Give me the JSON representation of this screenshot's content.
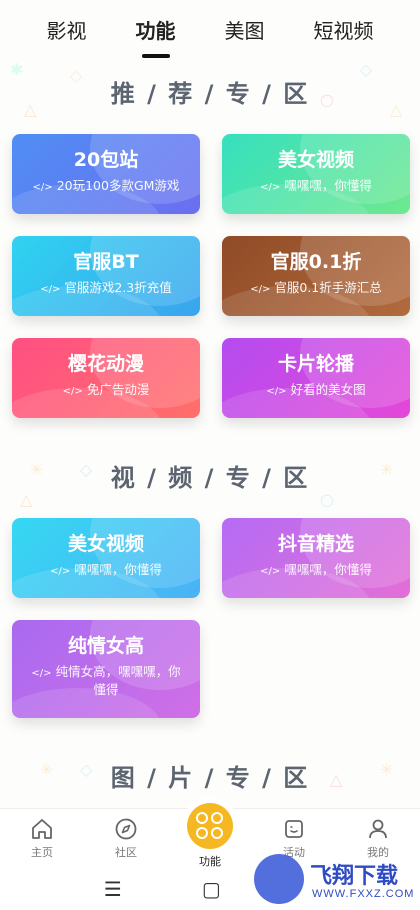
{
  "top_tabs": [
    {
      "label": "影视",
      "active": false
    },
    {
      "label": "功能",
      "active": true
    },
    {
      "label": "美图",
      "active": false
    },
    {
      "label": "短视频",
      "active": false
    }
  ],
  "sections": [
    {
      "title": "推 / 荐 / 专 / 区"
    },
    {
      "title": "视 / 频 / 专 / 区"
    },
    {
      "title": "图 / 片 / 专 / 区"
    }
  ],
  "code_glyph": "</>",
  "recommended_cards": [
    {
      "title": "20包站",
      "subtitle": "20玩100多款GM游戏",
      "color": "#5a80f2"
    },
    {
      "title": "美女视频",
      "subtitle": "嘿嘿嘿，你懂得",
      "color": "#4ae4b0"
    },
    {
      "title": "官服BT",
      "subtitle": "官服游戏2.3折充值",
      "color": "#31c4ef"
    },
    {
      "title": "官服0.1折",
      "subtitle": "官服0.1折手游汇总",
      "color": "#9c5630"
    },
    {
      "title": "樱花动漫",
      "subtitle": "免广告动漫",
      "color": "#ff5878"
    },
    {
      "title": "卡片轮播",
      "subtitle": "好看的美女图",
      "color": "#c94ae6"
    }
  ],
  "video_cards": [
    {
      "title": "美女视频",
      "subtitle": "嘿嘿嘿，你懂得",
      "color": "#3ec8f3"
    },
    {
      "title": "抖音精选",
      "subtitle": "嘿嘿嘿，你懂得",
      "color": "#cc6ee6"
    },
    {
      "title": "纯情女高",
      "subtitle": "纯情女高，嘿嘿嘿，你懂得",
      "color": "#bc6cee"
    }
  ],
  "bottom_nav": [
    {
      "label": "主页",
      "icon": "home-icon"
    },
    {
      "label": "社区",
      "icon": "compass-icon"
    },
    {
      "label": "功能",
      "icon": "grid-icon",
      "active": true
    },
    {
      "label": "活动",
      "icon": "activity-icon"
    },
    {
      "label": "我的",
      "icon": "user-icon"
    }
  ],
  "system_bar": {
    "menu": "☰",
    "home": "▢"
  },
  "watermark": {
    "name": "飞翔下载",
    "url": "WWW.FXXZ.COM"
  },
  "accent": "#f6b822"
}
